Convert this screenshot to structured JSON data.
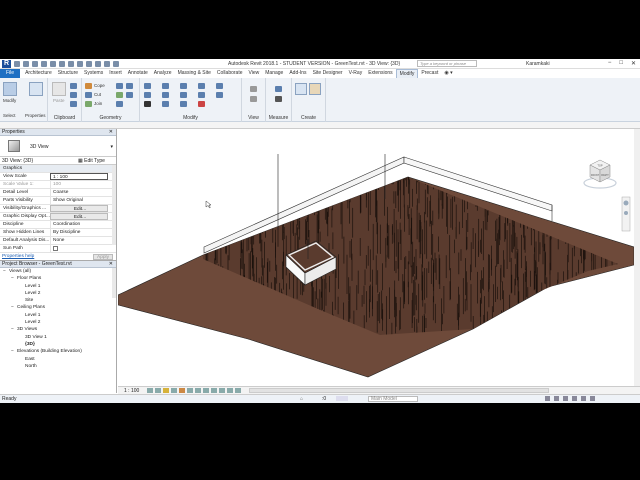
{
  "app": {
    "logo": "R",
    "title": "Autodesk Revit 2018.1 - STUDENT VERSION -   GreenTest.rvt - 3D View: {3D}",
    "search_placeholder": "Type a keyword or phrase",
    "user": "Karamkaki"
  },
  "ribbon": {
    "tabs": [
      "File",
      "Architecture",
      "Structure",
      "Systems",
      "Insert",
      "Annotate",
      "Analyze",
      "Massing & Site",
      "Collaborate",
      "View",
      "Manage",
      "Add-Ins",
      "Site Designer",
      "V-Ray",
      "Extensions",
      "Modify",
      "Precast"
    ],
    "active_tab": "Modify",
    "modify_label": "Modify",
    "select_label": "Select",
    "properties_label": "Properties",
    "clipboard_label": "Clipboard",
    "paste_label": "Paste",
    "geometry_label": "Geometry",
    "cope_label": "Cope",
    "cut_label": "Cut",
    "join_label": "Join",
    "modify_panel_label": "Modify",
    "view_label": "View",
    "measure_label": "Measure",
    "create_label": "Create"
  },
  "properties": {
    "header": "Properties",
    "type_name": "3D View",
    "instance": "3D View: {3D}",
    "edit_type": "Edit Type",
    "group": "Graphics",
    "rows": [
      {
        "k": "View Scale",
        "v": "1 : 100"
      },
      {
        "k": "Scale Value   1:",
        "v": "100"
      },
      {
        "k": "Detail Level",
        "v": "Coarse"
      },
      {
        "k": "Parts Visibility",
        "v": "Show Original"
      },
      {
        "k": "Visibility/Graphics ...",
        "v": "Edit..."
      },
      {
        "k": "Graphic Display Opt...",
        "v": "Edit..."
      },
      {
        "k": "Discipline",
        "v": "Coordination"
      },
      {
        "k": "Show Hidden Lines",
        "v": "By Discipline"
      },
      {
        "k": "Default Analysis Dis...",
        "v": "None"
      },
      {
        "k": "Sun Path",
        "v": ""
      }
    ],
    "help_link": "Properties help",
    "apply": "Apply"
  },
  "browser": {
    "header": "Project Browser - GreenTest.rvt",
    "items": [
      {
        "label": "Views (all)",
        "level": 0,
        "toggle": "−"
      },
      {
        "label": "Floor Plans",
        "level": 1,
        "toggle": "−"
      },
      {
        "label": "Level 1",
        "level": 2,
        "toggle": ""
      },
      {
        "label": "Level 2",
        "level": 2,
        "toggle": ""
      },
      {
        "label": "Site",
        "level": 2,
        "toggle": ""
      },
      {
        "label": "Ceiling Plans",
        "level": 1,
        "toggle": "−"
      },
      {
        "label": "Level 1",
        "level": 2,
        "toggle": ""
      },
      {
        "label": "Level 2",
        "level": 2,
        "toggle": ""
      },
      {
        "label": "3D Views",
        "level": 1,
        "toggle": "−"
      },
      {
        "label": "3D View 1",
        "level": 2,
        "toggle": ""
      },
      {
        "label": "{3D}",
        "level": 2,
        "toggle": "",
        "bold": true
      },
      {
        "label": "Elevations (Building Elevation)",
        "level": 1,
        "toggle": "−"
      },
      {
        "label": "East",
        "level": 2,
        "toggle": ""
      },
      {
        "label": "North",
        "level": 2,
        "toggle": ""
      }
    ]
  },
  "viewcube": {
    "top": "TOP",
    "front": "FRONT",
    "right": "RIGHT"
  },
  "view_bar": {
    "scale": "1 : 100"
  },
  "status": {
    "text": "Ready",
    "model": "Main Model",
    "zero": ":0"
  }
}
